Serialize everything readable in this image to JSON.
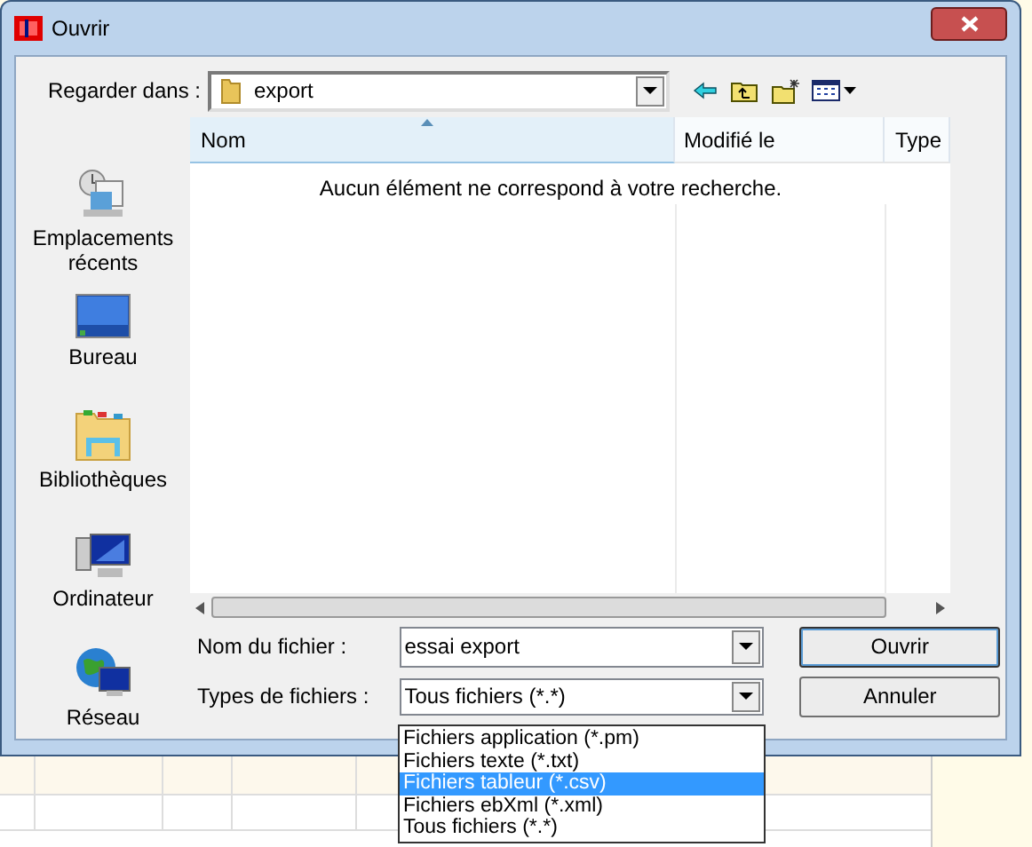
{
  "window": {
    "title": "Ouvrir"
  },
  "look_in": {
    "label": "Regarder dans :",
    "value": "export"
  },
  "places": [
    {
      "kind": "recent",
      "label": "Emplacements récents"
    },
    {
      "kind": "desktop",
      "label": "Bureau"
    },
    {
      "kind": "libraries",
      "label": "Bibliothèques"
    },
    {
      "kind": "computer",
      "label": "Ordinateur"
    },
    {
      "kind": "network",
      "label": "Réseau"
    }
  ],
  "file_list": {
    "columns": [
      {
        "label": "Nom",
        "sorted": true
      },
      {
        "label": "Modifié le",
        "sorted": false
      },
      {
        "label": "Type",
        "sorted": false
      }
    ],
    "empty_message": "Aucun élément ne correspond à votre recherche."
  },
  "file_name": {
    "label": "Nom du fichier :",
    "value": "essai export"
  },
  "file_type": {
    "label": "Types de fichiers :",
    "value": "Tous fichiers (*.*)",
    "expanded": true,
    "options": [
      {
        "label": "Fichiers application (*.pm)",
        "highlighted": false
      },
      {
        "label": "Fichiers texte (*.txt)",
        "highlighted": false
      },
      {
        "label": "Fichiers tableur (*.csv)",
        "highlighted": true
      },
      {
        "label": "Fichiers ebXml (*.xml)",
        "highlighted": false
      },
      {
        "label": "Tous fichiers (*.*)",
        "highlighted": false
      }
    ]
  },
  "buttons": [
    {
      "kind": "primary",
      "label": "Ouvrir"
    },
    {
      "kind": "cancel",
      "label": "Annuler"
    }
  ]
}
